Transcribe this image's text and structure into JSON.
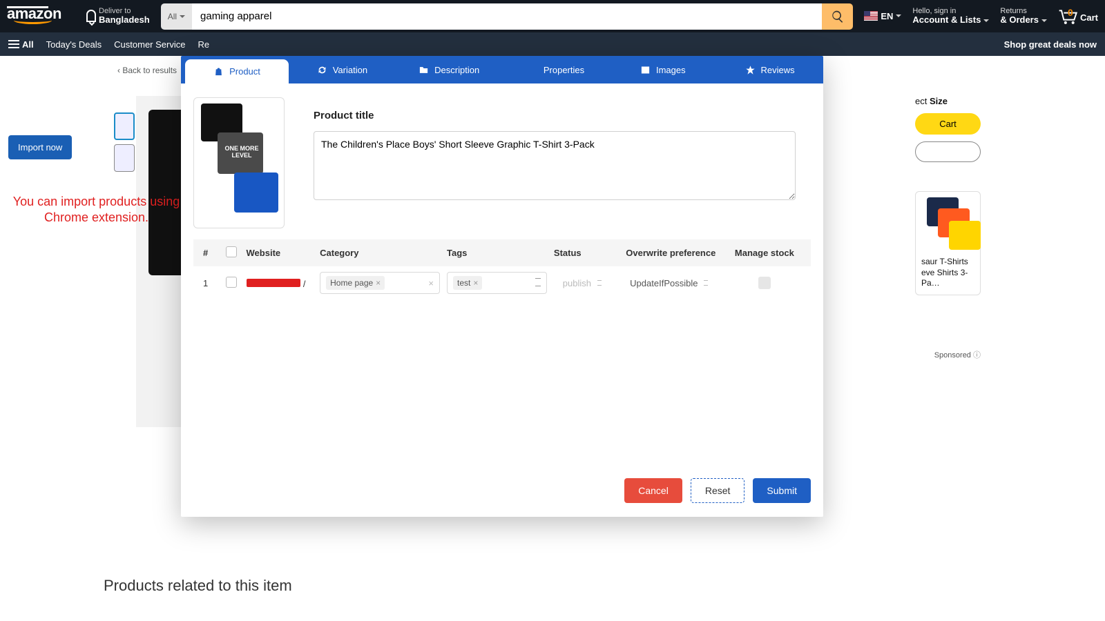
{
  "header": {
    "deliver_l1": "Deliver to",
    "deliver_l2": "Bangladesh",
    "search_cat": "All",
    "search_value": "gaming apparel",
    "lang": "EN",
    "signin_l1": "Hello, sign in",
    "signin_l2": "Account & Lists",
    "returns_l1": "Returns",
    "returns_l2": "& Orders",
    "cart_count": "0",
    "cart_label": "Cart"
  },
  "subnav": {
    "all": "All",
    "items": [
      "Today's Deals",
      "Customer Service",
      "Re"
    ],
    "promo": "Shop great deals now"
  },
  "page": {
    "back": "Back to results",
    "import_btn": "Import now",
    "import_note": "You can import products using Chrome extension.",
    "size_label": "ect",
    "size_bold": "Size",
    "cart_btn": "Cart",
    "sponsor_title": "saur T-Shirts eve Shirts 3-Pa…",
    "sponsored": "Sponsored",
    "related": "Products related to this item"
  },
  "panel": {
    "tabs": {
      "product": "Product",
      "variation": "Variation",
      "description": "Description",
      "properties": "Properties",
      "images": "Images",
      "reviews": "Reviews"
    },
    "title_label": "Product title",
    "title_value": "The Children's Place Boys' Short Sleeve Graphic T-Shirt 3-Pack",
    "thumb_text": "ONE MORE LEVEL",
    "table": {
      "heads": {
        "n": "#",
        "web": "Website",
        "cat": "Category",
        "tag": "Tags",
        "stat": "Status",
        "ovr": "Overwrite preference",
        "stock": "Manage stock"
      },
      "row": {
        "n": "1",
        "cat_chip": "Home page",
        "tag_chip": "test",
        "status": "publish",
        "overwrite": "UpdateIfPossible"
      }
    },
    "buttons": {
      "cancel": "Cancel",
      "reset": "Reset",
      "submit": "Submit"
    }
  }
}
